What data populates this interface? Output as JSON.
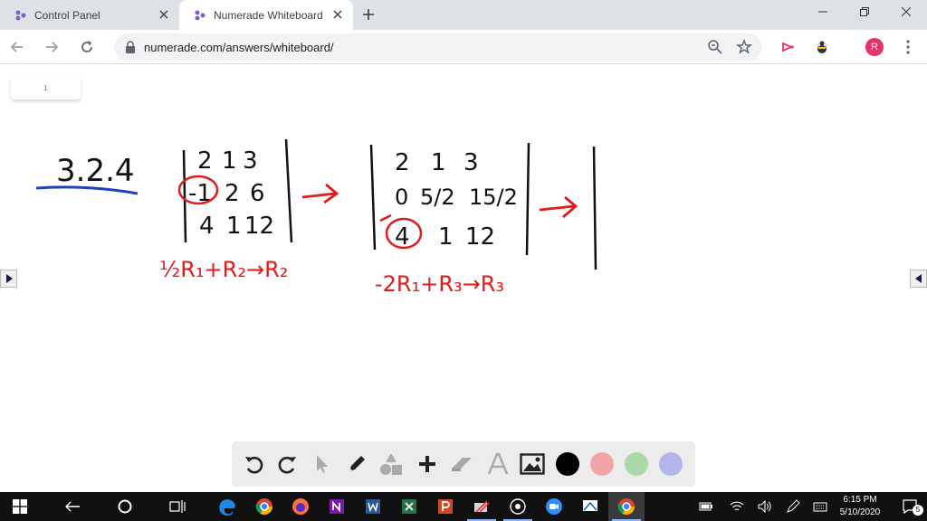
{
  "browser": {
    "tabs": [
      {
        "title": "Control Panel"
      },
      {
        "title": "Numerade Whiteboard"
      }
    ],
    "url": "numerade.com/answers/whiteboard/",
    "avatar_initial": "R"
  },
  "whiteboard": {
    "page_number": "1",
    "problem_label": "3.2.4",
    "matrix1": [
      [
        "2",
        "1",
        "3"
      ],
      [
        "-1",
        "2",
        "6"
      ],
      [
        "4",
        "1",
        "12"
      ]
    ],
    "op1": "½R₁+R₂→R₂",
    "matrix2": [
      [
        "2",
        "1",
        "3"
      ],
      [
        "0",
        "5/2",
        "15/2"
      ],
      [
        "4",
        "1",
        "12"
      ]
    ],
    "op2": "-2R₁+R₃→R₃"
  },
  "toolbar": {
    "colors": [
      "#000000",
      "#f1a5a5",
      "#a9d8a9",
      "#b3b5ec"
    ]
  },
  "taskbar": {
    "time": "6:15 PM",
    "date": "5/10/2020",
    "notifications": "5"
  }
}
